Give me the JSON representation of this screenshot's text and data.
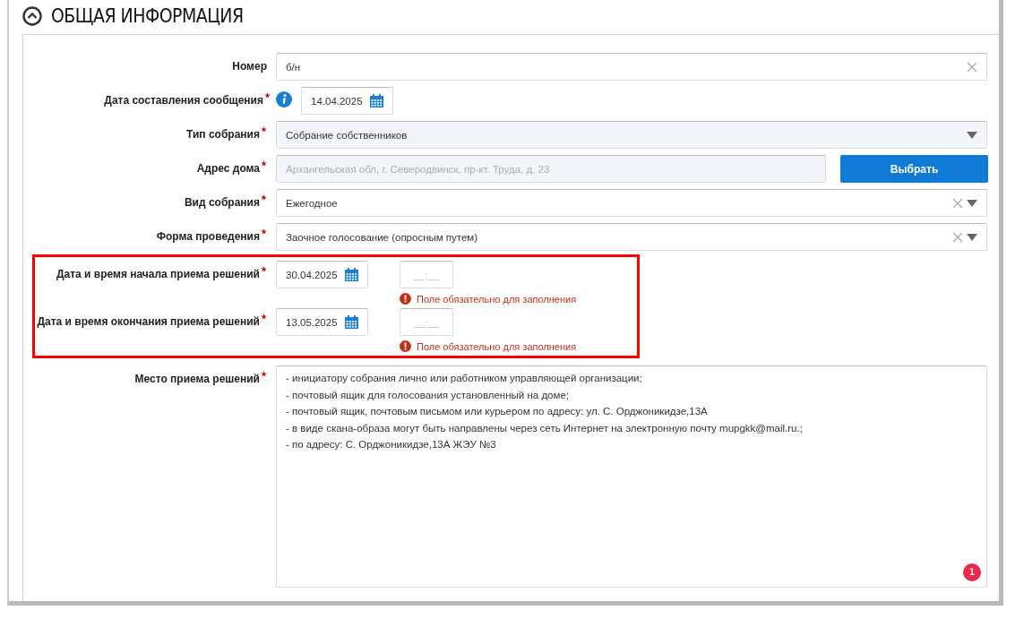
{
  "section": {
    "title": "ОБЩАЯ ИНФОРМАЦИЯ",
    "expanded": true
  },
  "fields": [
    {
      "kind": "text",
      "label": "Номер",
      "required": false,
      "value": "б/н",
      "clearable": true
    },
    {
      "kind": "date",
      "label": "Дата составления сообщения",
      "required": true,
      "info": true,
      "value": "14.04.2025"
    },
    {
      "kind": "select",
      "label": "Тип собрания",
      "required": true,
      "value": "Собрание собственников",
      "clearable": false,
      "disabled": true
    },
    {
      "kind": "address",
      "label": "Адрес дома",
      "required": true,
      "placeholder": "Архангельская обл, г. Северодвинск, пр-кт. Труда, д. 23",
      "button": "Выбрать"
    },
    {
      "kind": "select",
      "label": "Вид собрания",
      "required": true,
      "value": "Ежегодное",
      "clearable": true,
      "disabled": false
    },
    {
      "kind": "select",
      "label": "Форма проведения",
      "required": true,
      "value": "Заочное голосование (опросным путем)",
      "clearable": true,
      "disabled": false
    }
  ],
  "highlighted_fields": [
    {
      "kind": "datetime",
      "label": "Дата и время начала приема решений",
      "required": true,
      "value": "30.04.2025",
      "time_placeholder": "__:__",
      "error": "Поле обязательно для заполнения"
    },
    {
      "kind": "datetime",
      "label": "Дата и время окончания приема решений",
      "required": true,
      "value": "13.05.2025",
      "time_placeholder": "__:__",
      "error": "Поле обязательно для заполнения"
    }
  ],
  "place": {
    "label": "Место приема решений",
    "required": true,
    "lines": [
      "- инициатору собрания лично или работником управляющей организации;",
      "- почтовый ящик для голосования установленный на доме;",
      "- почтовый ящик, почтовым письмом или курьером по адресу: ул. С. Орджоникидзе,13А",
      "- в виде скана-образа могут быть направлены через сеть Интернет на электронную почту mupgkk@mail.ru.;",
      "- по адресу: С. Орджоникидзе,13А ЖЭУ №3"
    ],
    "badge": "1"
  }
}
